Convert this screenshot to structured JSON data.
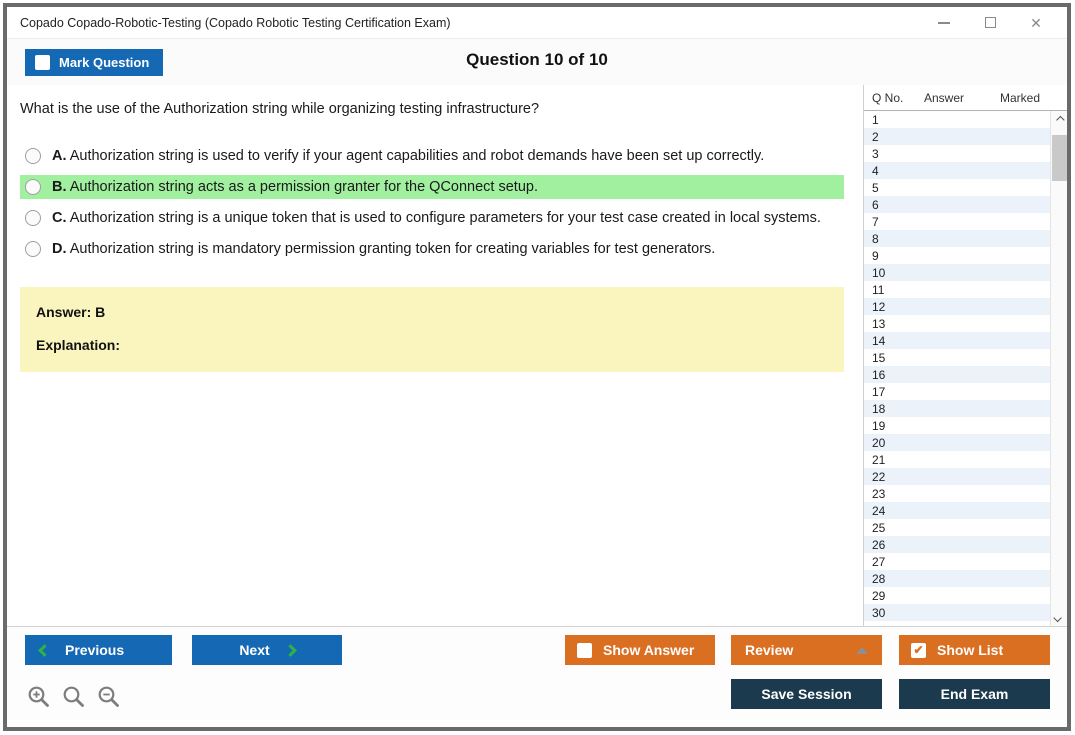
{
  "window": {
    "title": "Copado Copado-Robotic-Testing (Copado Robotic Testing Certification Exam)"
  },
  "icons": {
    "close": "✕",
    "check": "✔"
  },
  "header": {
    "mark_question_label": "Mark Question",
    "question_counter": "Question 10 of 10"
  },
  "question": {
    "text": "What is the use of the Authorization string while organizing testing infrastructure?",
    "options": [
      {
        "letter": "A.",
        "text": "Authorization string is used to verify if your agent capabilities and robot demands have been set up correctly.",
        "highlighted": false
      },
      {
        "letter": "B.",
        "text": "Authorization string acts as a permission granter for the QConnect setup.",
        "highlighted": true
      },
      {
        "letter": "C.",
        "text": "Authorization string is a unique token that is used to configure parameters for your test case created in local systems.",
        "highlighted": false
      },
      {
        "letter": "D.",
        "text": "Authorization string is mandatory permission granting token for creating variables for test generators.",
        "highlighted": false
      }
    ]
  },
  "answer_panel": {
    "answer_label": "Answer: B",
    "explanation_label": "Explanation:"
  },
  "sidebar": {
    "columns": {
      "q_no": "Q No.",
      "answer": "Answer",
      "marked": "Marked"
    },
    "rows": [
      "1",
      "2",
      "3",
      "4",
      "5",
      "6",
      "7",
      "8",
      "9",
      "10",
      "11",
      "12",
      "13",
      "14",
      "15",
      "16",
      "17",
      "18",
      "19",
      "20",
      "21",
      "22",
      "23",
      "24",
      "25",
      "26",
      "27",
      "28",
      "29",
      "30"
    ]
  },
  "footer": {
    "previous_label": "Previous",
    "next_label": "Next",
    "show_answer_label": "Show Answer",
    "review_label": "Review",
    "show_list_label": "Show List",
    "save_session_label": "Save Session",
    "end_exam_label": "End Exam"
  },
  "colors": {
    "blue": "#1568b3",
    "orange": "#da6e21",
    "navy": "#1b3a4d",
    "highlight_green": "#a0f0a0",
    "answer_yellow": "#faf5be",
    "alt_row_blue": "#ebf2f9",
    "chevron_green": "#2fb344"
  }
}
